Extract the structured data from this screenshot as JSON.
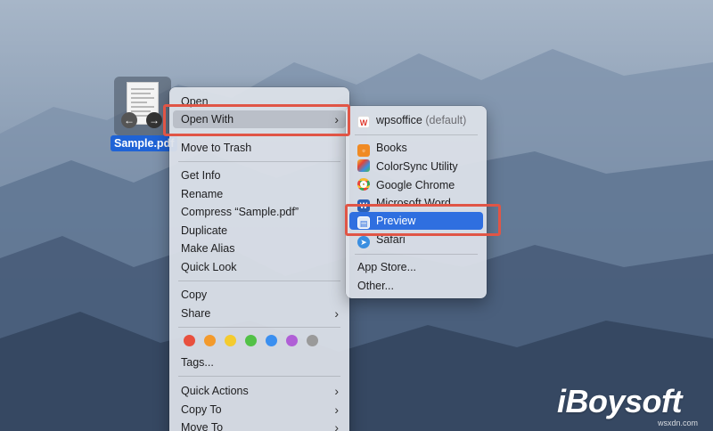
{
  "file": {
    "name": "Sample.pdf"
  },
  "context_menu": {
    "items": [
      {
        "label": "Open"
      },
      {
        "label": "Open With",
        "submenu": true
      },
      {
        "label": "Move to Trash"
      },
      {
        "label": "Get Info"
      },
      {
        "label": "Rename"
      },
      {
        "label": "Compress “Sample.pdf”"
      },
      {
        "label": "Duplicate"
      },
      {
        "label": "Make Alias"
      },
      {
        "label": "Quick Look"
      },
      {
        "label": "Copy"
      },
      {
        "label": "Share",
        "submenu": true
      },
      {
        "label": "Tags..."
      },
      {
        "label": "Quick Actions",
        "submenu": true
      },
      {
        "label": "Copy To",
        "submenu": true
      },
      {
        "label": "Move To",
        "submenu": true
      }
    ],
    "tag_colors": [
      "#e8503e",
      "#f39a2c",
      "#f4cb2f",
      "#52c147",
      "#3b8ff0",
      "#b05fd6",
      "#9a9a9a"
    ]
  },
  "open_with_menu": {
    "default_app": {
      "label": "wpsoffice",
      "suffix": "(default)",
      "icon": "wps-icon"
    },
    "apps": [
      {
        "label": "Books",
        "icon": "books-icon"
      },
      {
        "label": "ColorSync Utility",
        "icon": "colorsync-icon"
      },
      {
        "label": "Google Chrome",
        "icon": "chrome-icon"
      },
      {
        "label": "Microsoft Word",
        "icon": "word-icon"
      },
      {
        "label": "Preview",
        "icon": "preview-icon",
        "highlighted": true
      },
      {
        "label": "Safari",
        "icon": "safari-icon"
      }
    ],
    "app_store": "App Store...",
    "other": "Other..."
  },
  "branding": {
    "logo": "iBoysoft",
    "watermark": "wsxdn.com"
  },
  "colors": {
    "highlight": "#2f6fe0",
    "callout": "#e05546",
    "selection": "#1f63d6"
  }
}
